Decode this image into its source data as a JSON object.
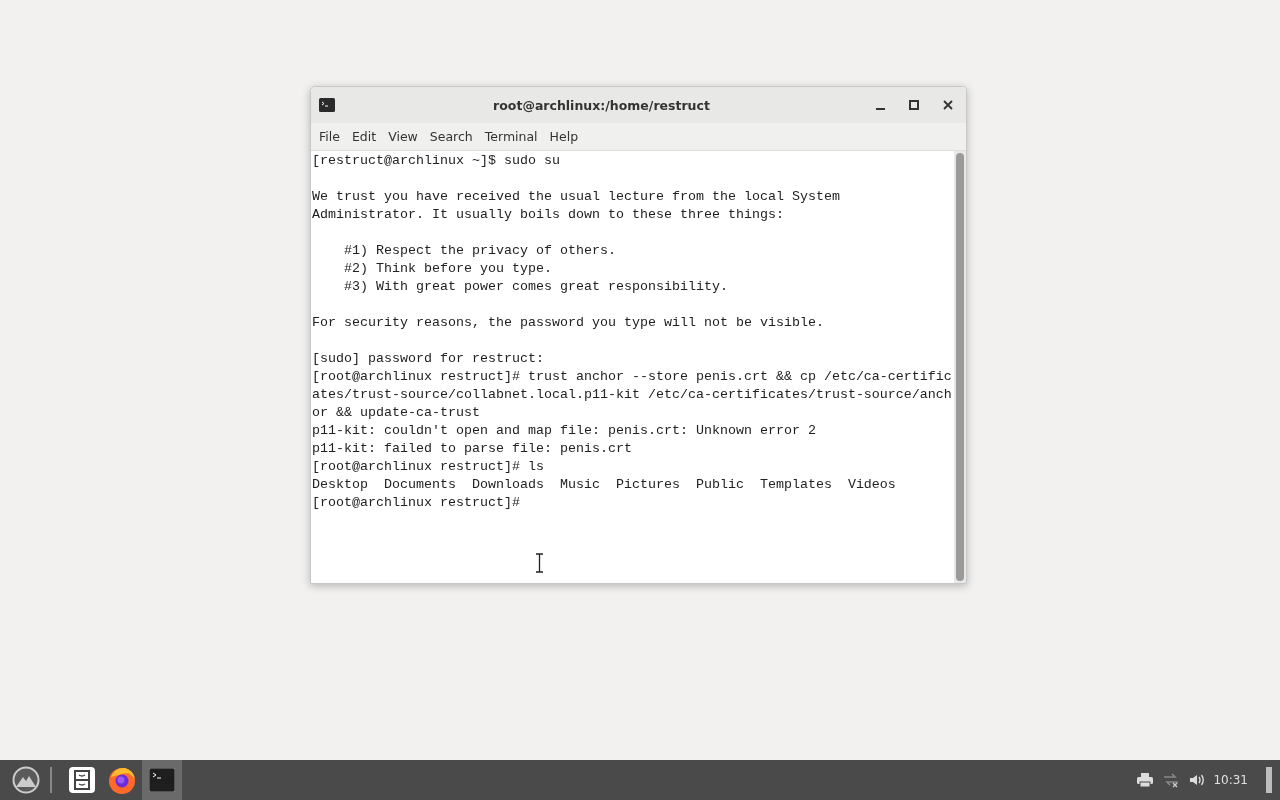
{
  "window": {
    "title": "root@archlinux:/home/restruct"
  },
  "menu": [
    "File",
    "Edit",
    "View",
    "Search",
    "Terminal",
    "Help"
  ],
  "terminal": {
    "blocks": [
      [
        "[restruct@archlinux ~]$ sudo su"
      ],
      [
        "We trust you have received the usual lecture from the local System",
        "Administrator. It usually boils down to these three things:"
      ],
      [
        "    #1) Respect the privacy of others.",
        "    #2) Think before you type.",
        "    #3) With great power comes great responsibility."
      ],
      [
        "For security reasons, the password you type will not be visible."
      ],
      [
        "[sudo] password for restruct:",
        "[root@archlinux restruct]# trust anchor --store penis.crt && cp /etc/ca-certific",
        "ates/trust-source/collabnet.local.p11-kit /etc/ca-certificates/trust-source/anch",
        "or && update-ca-trust",
        "p11-kit: couldn't open and map file: penis.crt: Unknown error 2",
        "p11-kit: failed to parse file: penis.crt",
        "[root@archlinux restruct]# ls",
        "Desktop  Documents  Downloads  Music  Pictures  Public  Templates  Videos",
        "[root@archlinux restruct]#"
      ]
    ]
  },
  "taskbar": {
    "apps": [
      {
        "kind": "files",
        "selected": false
      },
      {
        "kind": "browser",
        "selected": false
      },
      {
        "kind": "terminal",
        "selected": true
      }
    ],
    "clock": "10:31"
  }
}
